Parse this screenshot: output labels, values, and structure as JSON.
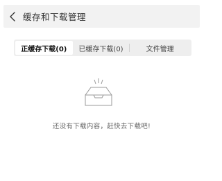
{
  "header": {
    "back_icon": "chevron-left-icon",
    "title": "缓存和下载管理"
  },
  "tabs": [
    {
      "label": "正缓存下载(0)",
      "active": true
    },
    {
      "label": "已缓存下载(0)",
      "active": false
    },
    {
      "label": "文件管理",
      "active": false
    }
  ],
  "empty_state": {
    "icon": "empty-tray-icon",
    "message": "还没有下载内容，赶快去下载吧!"
  },
  "colors": {
    "header_bg": "#f2f2f2",
    "tabs_bg": "#eeeeee",
    "active_tab_bg": "#ffffff",
    "text_primary": "#333333",
    "text_secondary": "#666666",
    "icon_stroke": "#9a9a9a"
  }
}
